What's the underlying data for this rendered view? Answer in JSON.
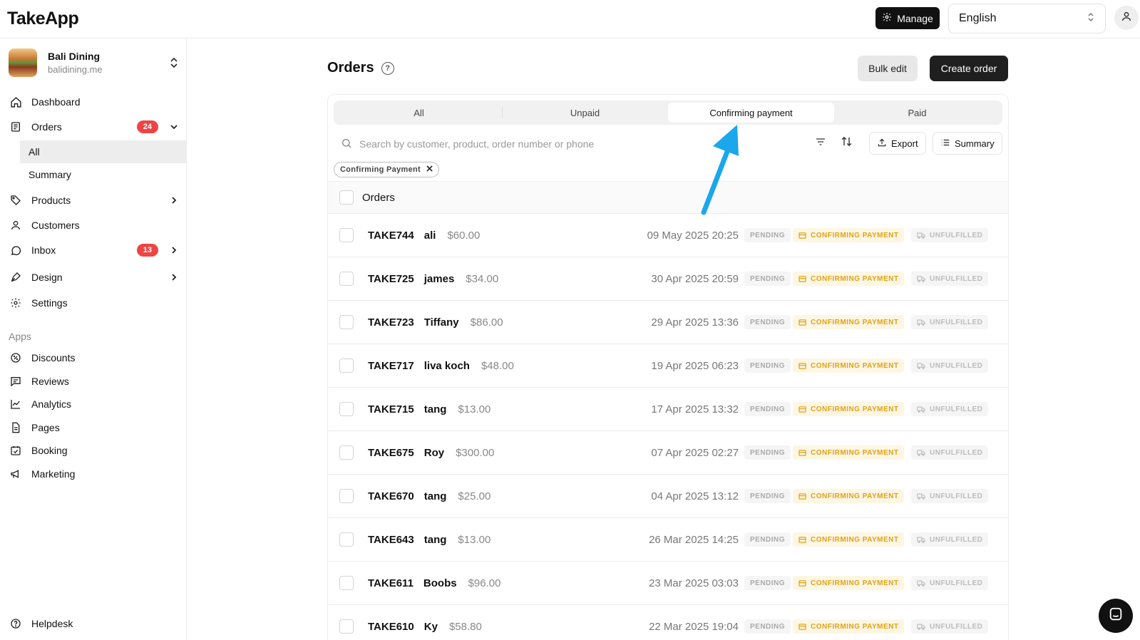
{
  "header": {
    "logo": "TakeApp",
    "manage_label": "Manage",
    "language": "English"
  },
  "store": {
    "name": "Bali Dining",
    "url": "balidining.me"
  },
  "sidebar": {
    "dashboard": "Dashboard",
    "orders": "Orders",
    "orders_badge": "24",
    "orders_sub": [
      "All",
      "Summary"
    ],
    "products": "Products",
    "customers": "Customers",
    "inbox": "Inbox",
    "inbox_badge": "13",
    "design": "Design",
    "settings": "Settings",
    "apps_label": "Apps",
    "apps": [
      "Discounts",
      "Reviews",
      "Analytics",
      "Pages",
      "Booking",
      "Marketing"
    ],
    "helpdesk": "Helpdesk"
  },
  "page": {
    "title": "Orders",
    "help": "?",
    "bulk_edit": "Bulk edit",
    "create_order": "Create order"
  },
  "tabs": [
    "All",
    "Unpaid",
    "Confirming payment",
    "Paid"
  ],
  "active_tab": "Confirming payment",
  "search": {
    "placeholder": "Search by customer, product, order number or phone"
  },
  "toolbar": {
    "export": "Export",
    "summary": "Summary"
  },
  "filter_chip": "Confirming Payment",
  "list_header": "Orders",
  "status_labels": {
    "payment_pending": "PENDING",
    "confirming": "CONFIRMING PAYMENT",
    "fulfillment": "UNFULFILLED"
  },
  "orders": [
    {
      "id": "TAKE744",
      "customer": "ali",
      "amount": "$60.00",
      "date": "09 May 2025 20:25"
    },
    {
      "id": "TAKE725",
      "customer": "james",
      "amount": "$34.00",
      "date": "30 Apr 2025 20:59"
    },
    {
      "id": "TAKE723",
      "customer": "Tiffany",
      "amount": "$86.00",
      "date": "29 Apr 2025 13:36"
    },
    {
      "id": "TAKE717",
      "customer": "liva koch",
      "amount": "$48.00",
      "date": "19 Apr 2025 06:23"
    },
    {
      "id": "TAKE715",
      "customer": "tang",
      "amount": "$13.00",
      "date": "17 Apr 2025 13:32"
    },
    {
      "id": "TAKE675",
      "customer": "Roy",
      "amount": "$300.00",
      "date": "07 Apr 2025 02:27"
    },
    {
      "id": "TAKE670",
      "customer": "tang",
      "amount": "$25.00",
      "date": "04 Apr 2025 13:12"
    },
    {
      "id": "TAKE643",
      "customer": "tang",
      "amount": "$13.00",
      "date": "26 Mar 2025 14:25"
    },
    {
      "id": "TAKE611",
      "customer": "Boobs",
      "amount": "$96.00",
      "date": "23 Mar 2025 03:03"
    },
    {
      "id": "TAKE610",
      "customer": "Ky",
      "amount": "$58.80",
      "date": "22 Mar 2025 19:04"
    }
  ],
  "colors": {
    "accent_dark": "#111111",
    "badge_red": "#ef4444",
    "confirming_amber": "#e0a21a",
    "annotation_arrow": "#1aa7ec"
  }
}
